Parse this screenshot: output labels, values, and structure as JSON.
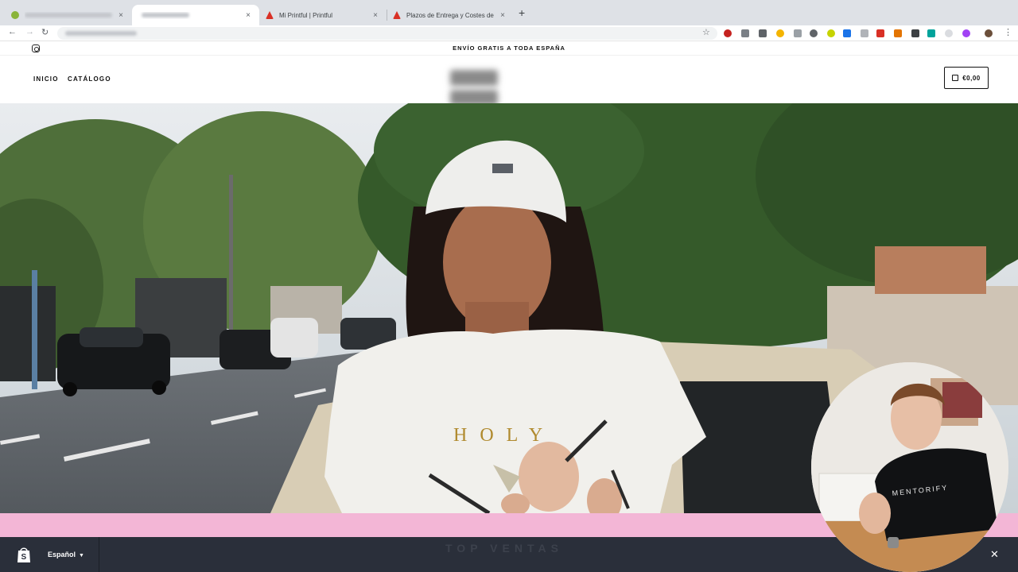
{
  "browser": {
    "tabs": [
      {
        "title": "",
        "favicon_color": "#8ab43a",
        "active": false
      },
      {
        "title": "",
        "favicon_color": "#ffffff",
        "active": true
      },
      {
        "title": "Mi Printful | Printful",
        "favicon_color": "#d93025",
        "active": false
      },
      {
        "title": "Plazos de Entrega y Costes de",
        "favicon_color": "#d93025",
        "active": false
      }
    ],
    "new_tab_label": "+",
    "close_glyph": "×"
  },
  "store": {
    "announcement": "ENVÍO GRATIS A TODA ESPAÑA",
    "nav": {
      "home": "INICIO",
      "catalog": "CATÁLOGO"
    },
    "cart_total": "€0,00",
    "hero_shirt_text": "HOLY"
  },
  "shopify_bar": {
    "language": "Español",
    "ghost_text": "TOP VENTAS",
    "close_glyph": "✕"
  },
  "webcam": {
    "shirt_text": "MENTORIFY"
  },
  "colors": {
    "pink_band": "#f3b6d6",
    "bottom_bar": "#2a2f3a",
    "shopify_green": "#95bf47"
  }
}
